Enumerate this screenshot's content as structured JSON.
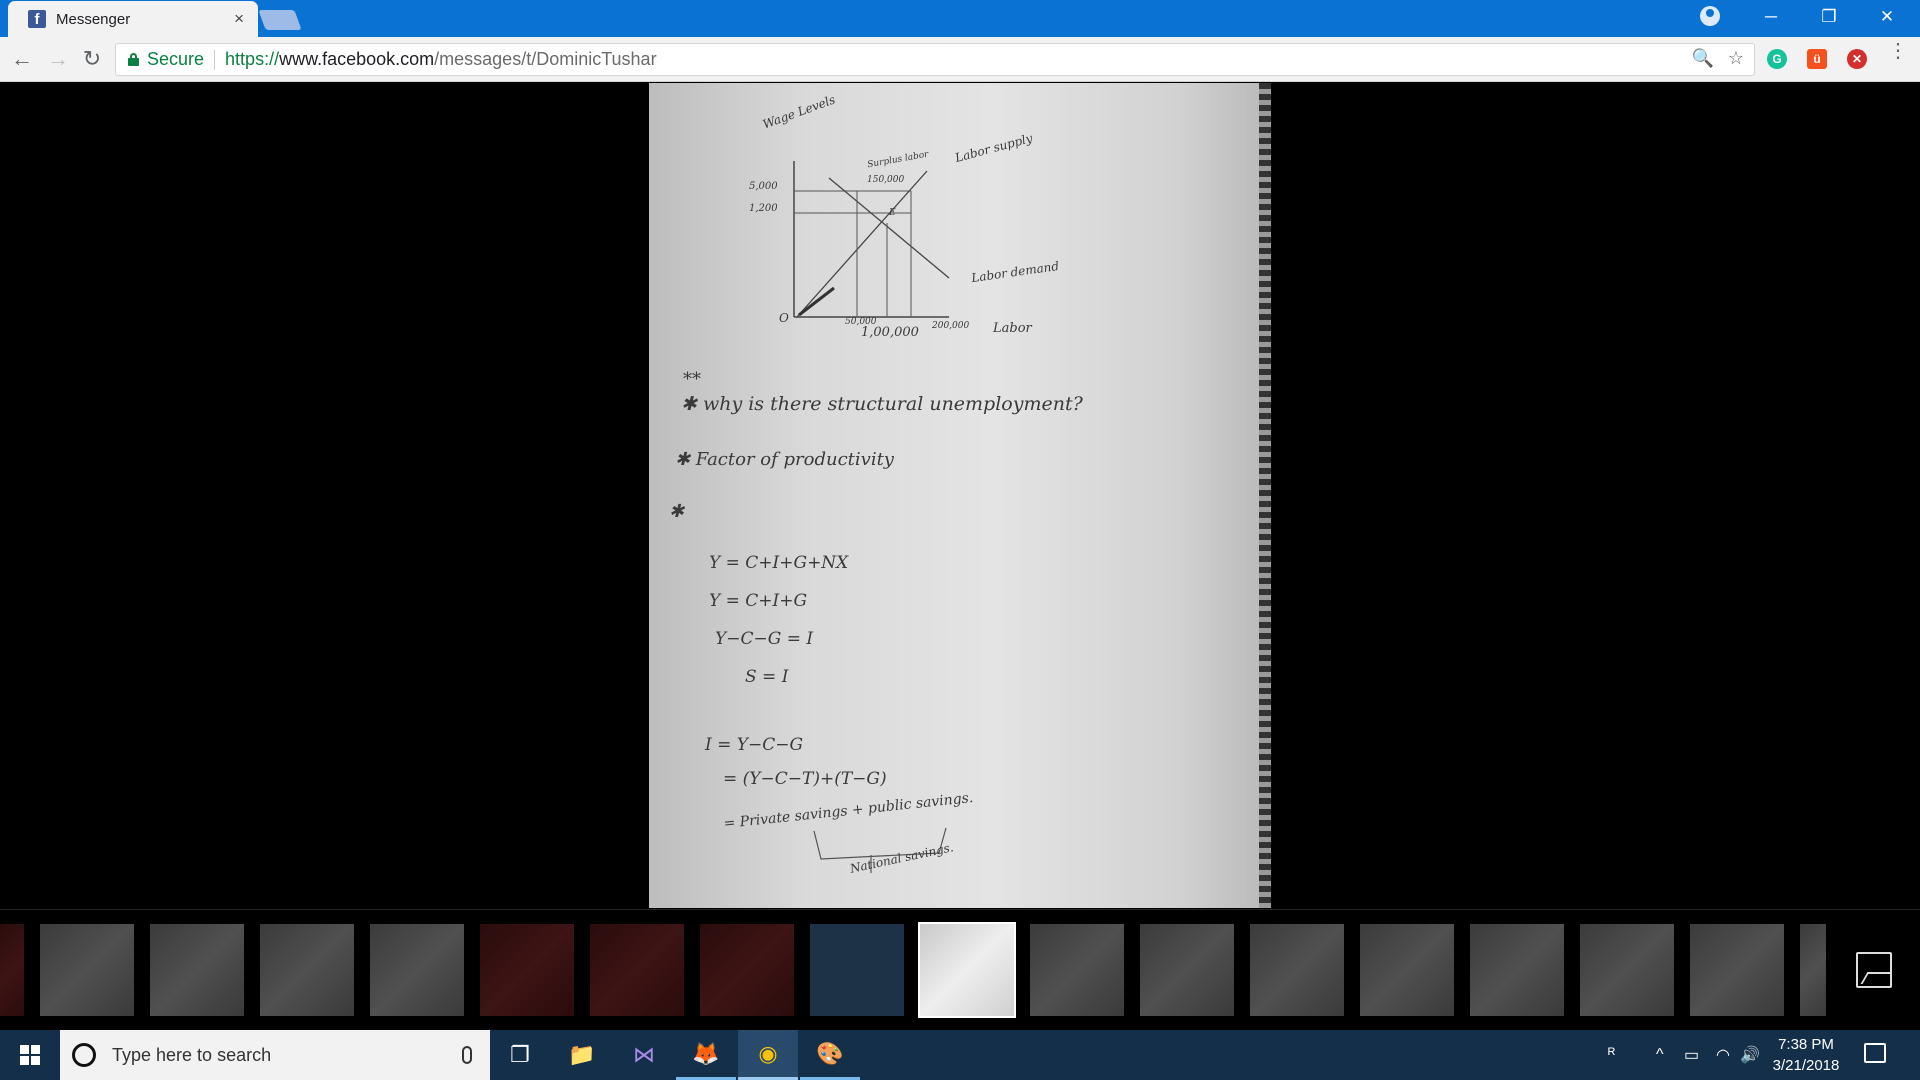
{
  "browser": {
    "tab": {
      "title": "Messenger",
      "close": "×",
      "favicon_letter": "f"
    },
    "window_controls": {
      "minimize": "─",
      "restore": "❐",
      "close": "✕"
    },
    "nav": {
      "back": "←",
      "forward": "→",
      "reload": "↻"
    },
    "omnibox": {
      "secure_label": "Secure",
      "url_protocol": "https://",
      "url_host": "www.facebook.com",
      "url_path": "/messages/t/DominicTushar",
      "zoom_icon": "🔍",
      "star_icon": "☆"
    },
    "extensions": [
      {
        "name": "grammarly-icon",
        "letter": "G",
        "color": "#15c39a"
      },
      {
        "name": "adblock-icon",
        "letter": "ü",
        "color": "#f4511e"
      },
      {
        "name": "blocker-icon",
        "letter": "✕",
        "color": "#d32f2f"
      }
    ],
    "menu": "⋮"
  },
  "photo": {
    "graph": {
      "y_axis_label": "Wage Levels",
      "y_ticks": [
        "5,000",
        "1,200"
      ],
      "origin": "O",
      "x_ticks": [
        "50,000",
        "1,00,000",
        "200,000"
      ],
      "x_axis_label": "Labor",
      "surplus_label": "Surplus labor",
      "surplus_value": "150,000",
      "equilibrium": "E",
      "supply_label": "Labor supply",
      "demand_label": "Labor demand"
    },
    "notes": [
      "**",
      "✱ why is there structural unemployment?",
      "✱ Factor of productivity",
      "✱",
      "Y = C+I+G+NX",
      "Y = C+I+G",
      "Y−C−G = I",
      "S = I",
      "I = Y−C−G",
      "= (Y−C−T)+(T−G)",
      "= Private savings  + public savings.",
      "National savings."
    ]
  },
  "thumbnails": [
    {
      "style": "red"
    },
    {
      "style": "gray"
    },
    {
      "style": "gray"
    },
    {
      "style": "gray"
    },
    {
      "style": "gray"
    },
    {
      "style": "red"
    },
    {
      "style": "red"
    },
    {
      "style": "red"
    },
    {
      "style": "blue"
    },
    {
      "style": "active"
    },
    {
      "style": "gray"
    },
    {
      "style": "gray"
    },
    {
      "style": "gray"
    },
    {
      "style": "gray"
    },
    {
      "style": "gray"
    },
    {
      "style": "gray"
    },
    {
      "style": "gray"
    },
    {
      "style": "gray"
    }
  ],
  "taskbar": {
    "search_placeholder": "Type here to search",
    "apps": [
      {
        "name": "task-view-icon",
        "glyph": "❐"
      },
      {
        "name": "file-explorer-icon",
        "glyph": "📁"
      },
      {
        "name": "visual-studio-icon",
        "glyph": "⋈"
      },
      {
        "name": "firefox-icon",
        "glyph": "🦊"
      },
      {
        "name": "chrome-icon",
        "glyph": "◉"
      },
      {
        "name": "paint-icon",
        "glyph": "🎨"
      }
    ],
    "tray": {
      "people": "ᴿ",
      "chevron": "^",
      "battery": "▭",
      "wifi": "◠",
      "volume": "🔊"
    },
    "time": "7:38 PM",
    "date": "3/21/2018"
  }
}
